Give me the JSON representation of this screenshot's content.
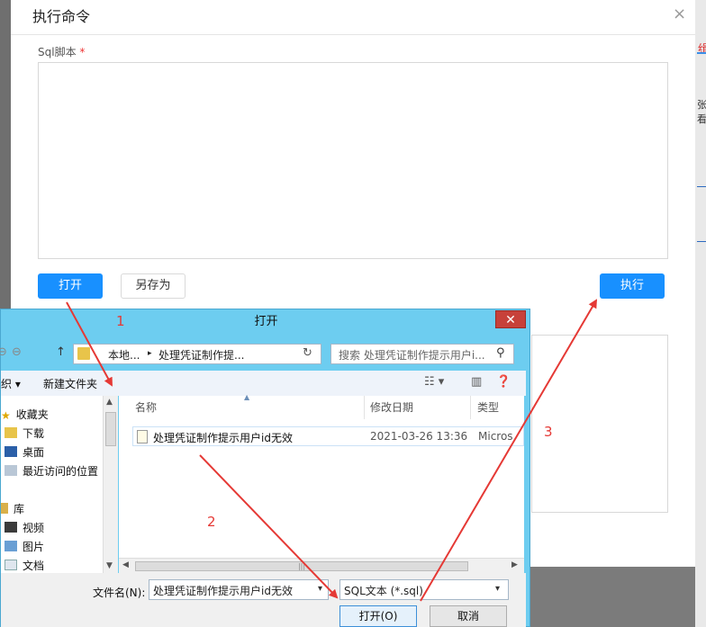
{
  "modal": {
    "title": "执行命令",
    "close_glyph": "×",
    "sql_label": "Sql脚本",
    "required_mark": "*",
    "open_button": "打开",
    "save_as_button": "另存为",
    "execute_button": "执行"
  },
  "background": {
    "red_text": "缉",
    "side_text": "张看"
  },
  "file_dialog": {
    "title": "打开",
    "close_glyph": "✕",
    "nav": {
      "back": "⊖",
      "forward": "⊖",
      "up": "↑"
    },
    "address": {
      "part1": "本地...",
      "sep": "▸",
      "part2": "处理凭证制作提...",
      "refresh": "↻"
    },
    "search_placeholder": "搜索 处理凭证制作提示用户i...",
    "toolbar": {
      "organize": "织 ▾",
      "new_folder": "新建文件夹"
    },
    "tree": [
      {
        "label": "收藏夹"
      },
      {
        "label": "下载"
      },
      {
        "label": "桌面"
      },
      {
        "label": "最近访问的位置"
      },
      {
        "label": "库"
      },
      {
        "label": "视频"
      },
      {
        "label": "图片"
      },
      {
        "label": "文档"
      }
    ],
    "columns": {
      "name": "名称",
      "modified": "修改日期",
      "type": "类型"
    },
    "files": [
      {
        "name": "处理凭证制作提示用户id无效",
        "modified": "2021-03-26 13:36",
        "type": "Micros"
      }
    ],
    "filename_label": "文件名(N):",
    "filename_value": "处理凭证制作提示用户id无效",
    "filetype_value": "SQL文本 (*.sql)",
    "open_button": "打开(O)",
    "cancel_button": "取消"
  },
  "annotations": {
    "step1": "1",
    "step2": "2",
    "step3": "3"
  },
  "colors": {
    "primary": "#1890ff",
    "dialog_frame": "#6dcdf0",
    "annotation": "#e53935"
  }
}
